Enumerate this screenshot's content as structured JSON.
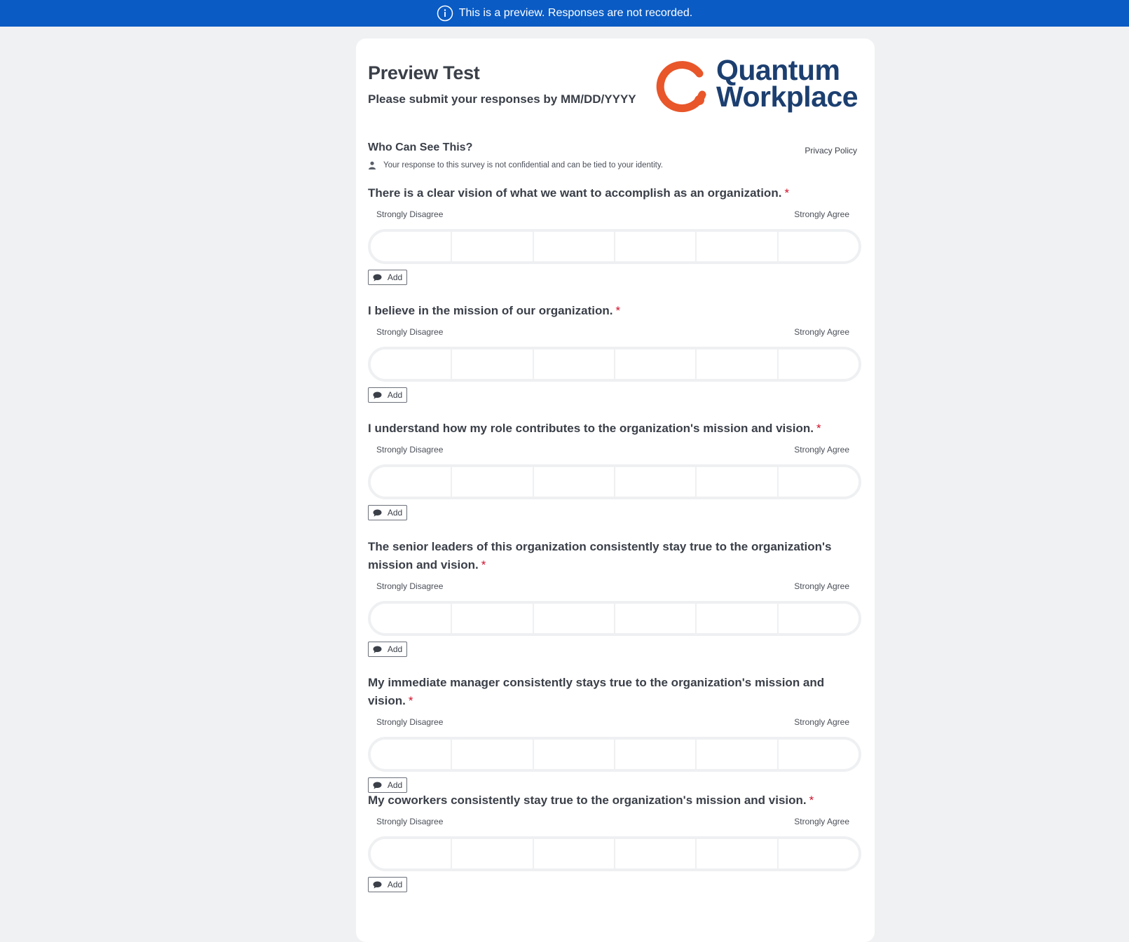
{
  "banner": {
    "text": "This is a preview. Responses are not recorded.",
    "icon": "info-icon"
  },
  "survey": {
    "title": "Preview Test",
    "subtitle": "Please submit your responses by MM/DD/YYYY",
    "logo_lines": [
      "Quantum",
      "Workplace"
    ]
  },
  "privacy": {
    "heading": "Who Can See This?",
    "link": "Privacy Policy",
    "note": "Your response to this survey is not confidential and can be tied to your identity."
  },
  "scale": {
    "left_label": "Strongly Disagree",
    "right_label": "Strongly Agree",
    "options_count": 6
  },
  "add_label": "Add",
  "required_mark": "*",
  "questions": [
    {
      "text": "There is a clear vision of what we want to accomplish as an organization."
    },
    {
      "text": "I believe in the mission of our organization."
    },
    {
      "text": "I understand how my role contributes to the organization's mission and vision."
    },
    {
      "text": "The senior leaders of this organization consistently stay true to the organization's mission and vision."
    },
    {
      "text": "My immediate manager consistently stays true to the organization's mission and vision."
    },
    {
      "text": "My coworkers consistently stay true to the organization's mission and vision."
    }
  ],
  "colors": {
    "banner": "#0a5bc4",
    "logo_orange": "#e8562a",
    "logo_navy": "#1c3f70",
    "required": "#d0102a"
  }
}
